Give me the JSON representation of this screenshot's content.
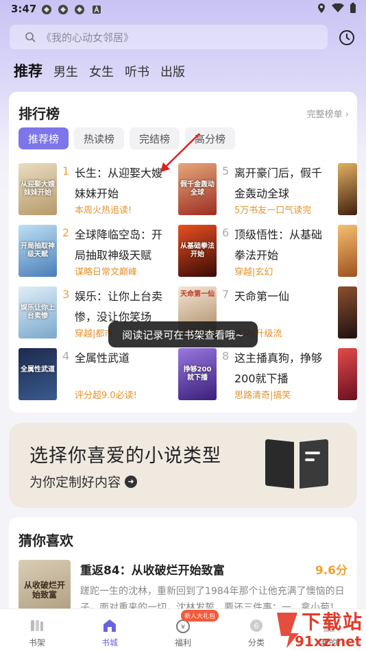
{
  "status_bar": {
    "time": "3:47"
  },
  "search": {
    "placeholder": "《我的心动女邻居》"
  },
  "category_tabs": [
    {
      "label": "推荐",
      "active": true
    },
    {
      "label": "男生"
    },
    {
      "label": "女生"
    },
    {
      "label": "听书"
    },
    {
      "label": "出版"
    }
  ],
  "ranking": {
    "title": "排行榜",
    "full_list_label": "完整榜单",
    "subtabs": [
      "推荐榜",
      "热读榜",
      "完结榜",
      "高分榜"
    ],
    "books": [
      {
        "rank": "1",
        "title": "长生：从迎娶大嫂妹妹开始",
        "tag": "本周火热追读!",
        "cover_text": "从迎娶大嫂妹妹开始",
        "cover_color": "#c9b48a"
      },
      {
        "rank": "2",
        "title": "全球降临空岛：开局抽取神级天赋",
        "tag": "谋略日常文巅峰",
        "cover_text": "开局抽取神级天赋",
        "cover_color": "#6fa6d8"
      },
      {
        "rank": "3",
        "title": "娱乐：让你上台卖惨，没让你笑场",
        "tag": "穿越|都市",
        "cover_text": "娱乐让你上台卖惨",
        "cover_color": "#9fc7e6"
      },
      {
        "rank": "4",
        "title": "全属性武道",
        "tag": "评分超9.0必读!",
        "cover_text": "全属性武道",
        "cover_color": "#2a3d64"
      },
      {
        "rank": "5",
        "title": "离开豪门后，假千金轰动全球",
        "tag": "5万书友一口气读完",
        "cover_text": "假千金轰动全球",
        "cover_color": "#c24a3a"
      },
      {
        "rank": "6",
        "title": "顶级悟性：从基础拳法开始",
        "tag": "穿越|玄幻",
        "cover_text": "从基础拳法开始",
        "cover_color": "#8a1b10"
      },
      {
        "rank": "7",
        "title": "天命第一仙",
        "tag": "练功|升级流",
        "cover_text": "天命第一仙",
        "cover_color": "#e9d9c6"
      },
      {
        "rank": "8",
        "title": "这主播真狗，挣够200就下播",
        "tag": "思路清奇|搞笑",
        "cover_text": "挣够200就下播",
        "cover_color": "#5b3aa8"
      }
    ]
  },
  "toast": "阅读记录可在书架查看哦~",
  "genre_banner": {
    "title": "选择你喜爱的小说类型",
    "subtitle": "为你定制好内容"
  },
  "guess": {
    "title": "猜你喜欢",
    "book_title": "重返84：从收破烂开始致富",
    "score": "9.6分",
    "description": "蹉跎一生的沈林，重新回到了1984年那个让他充满了懊恼的日子。面对重来的一切，沈林发誓，要还三件事：一，拿小菊！",
    "cover_text": "从收破烂开始致富"
  },
  "bottom_nav": [
    {
      "label": "书架",
      "icon": "bookshelf-icon"
    },
    {
      "label": "书城",
      "icon": "bookstore-icon",
      "active": true
    },
    {
      "label": "福利",
      "icon": "gift-icon"
    },
    {
      "label": "分类",
      "icon": "category-icon"
    },
    {
      "label": "我的",
      "icon": "user-icon"
    }
  ],
  "nav_badge": "新人大礼包",
  "watermark": {
    "text": "下载站",
    "url": "91xz.net"
  }
}
